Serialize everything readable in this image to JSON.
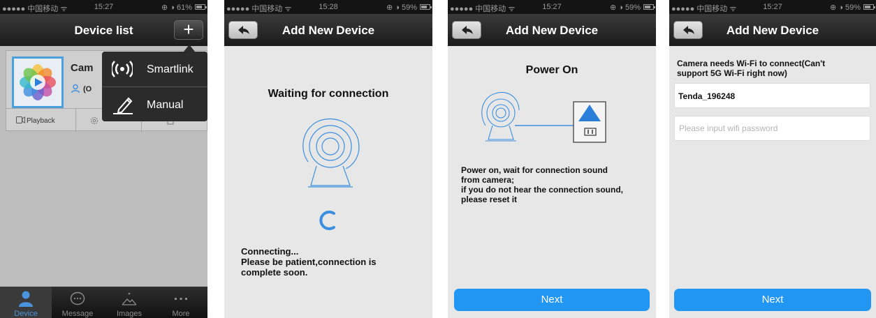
{
  "status_bars": [
    {
      "carrier": "●●●●● 中国移动 ᯤ",
      "time": "15:27",
      "right": "⊕ ◑ 61%",
      "battery_level": 0.61
    },
    {
      "carrier": "●●●●● 中国移动 ᯤ",
      "time": "15:28",
      "right": "⊕ ◑ 59%",
      "battery_level": 0.59
    },
    {
      "carrier": "●●●●● 中国移动 ᯤ",
      "time": "15:27",
      "right": "⊕ ◑ 59%",
      "battery_level": 0.59
    },
    {
      "carrier": "●●●●● 中国移动 ᯤ",
      "time": "15:27",
      "right": "⊕ ◑ 59%",
      "battery_level": 0.59
    }
  ],
  "device_list": {
    "title": "Device list",
    "add_label": "+",
    "device": {
      "name": "Cam",
      "status": "(O"
    },
    "actions": {
      "playback": "Playback"
    },
    "popup": {
      "smartlink": "Smartlink",
      "manual": "Manual"
    },
    "tabs": [
      {
        "label": "Device",
        "icon": "person-icon",
        "active": true
      },
      {
        "label": "Message",
        "icon": "chat-bubble-icon",
        "active": false
      },
      {
        "label": "Images",
        "icon": "picture-icon",
        "active": false
      },
      {
        "label": "More",
        "icon": "more-dots-icon",
        "active": false
      }
    ]
  },
  "waiting_screen": {
    "title": "Add New Device",
    "heading": "Waiting for connection",
    "message_lines": [
      "Connecting...",
      "Please be patient,connection is",
      "complete soon."
    ]
  },
  "power_screen": {
    "title": "Add New Device",
    "heading": "Power On",
    "message_lines": [
      "Power on, wait for connection sound",
      "from camera;",
      "if you do not hear the connection sound,",
      "please reset it"
    ],
    "next_label": "Next"
  },
  "wifi_screen": {
    "title": "Add New Device",
    "label_lines": [
      "Camera needs Wi-Fi to connect(Can't",
      "support 5G Wi-Fi right now)"
    ],
    "ssid_value": "Tenda_196248",
    "password_placeholder": "Please input wifi password",
    "next_label": "Next"
  },
  "colors": {
    "accent": "#2196f3",
    "tab_active": "#4a94de",
    "thumb_border": "#4aa0dc"
  }
}
